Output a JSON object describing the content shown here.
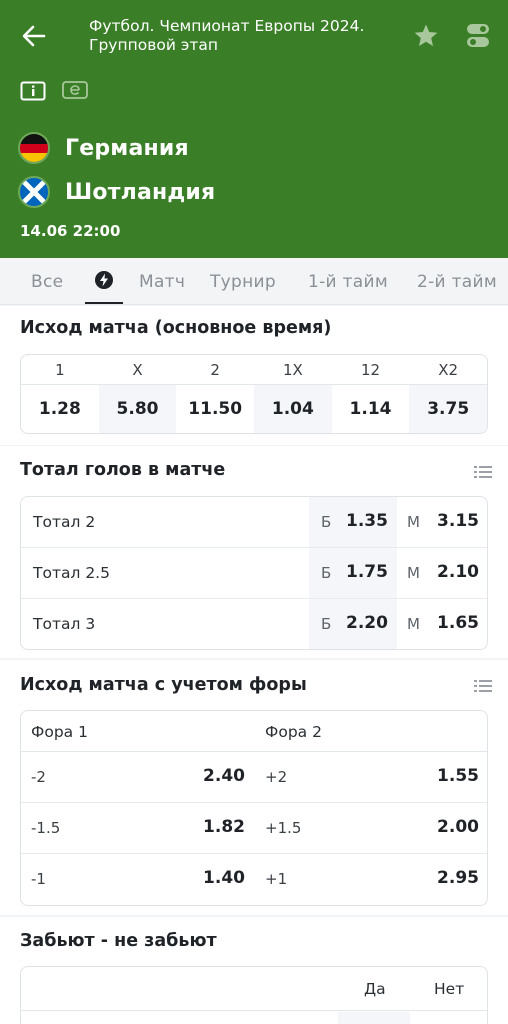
{
  "header": {
    "title_line1": "Футбол. Чемпионат Европы 2024.",
    "title_line2": "Групповой этап",
    "team1": "Германия",
    "team2": "Шотландия",
    "datetime": "14.06 22:00",
    "bg_color": "#3a7f27"
  },
  "tabs": [
    "Все",
    "Матч",
    "Турнир",
    "1-й тайм",
    "2-й тайм"
  ],
  "match_result": {
    "title": "Исход матча (основное время)",
    "columns": [
      {
        "label": "1",
        "odds": "1.28"
      },
      {
        "label": "X",
        "odds": "5.80"
      },
      {
        "label": "2",
        "odds": "11.50"
      },
      {
        "label": "1X",
        "odds": "1.04"
      },
      {
        "label": "12",
        "odds": "1.14"
      },
      {
        "label": "X2",
        "odds": "3.75"
      }
    ]
  },
  "totals": {
    "title": "Тотал голов в матче",
    "over_prefix": "Б",
    "under_prefix": "М",
    "rows": [
      {
        "label": "Тотал 2",
        "over": "1.35",
        "under": "3.15"
      },
      {
        "label": "Тотал 2.5",
        "over": "1.75",
        "under": "2.10"
      },
      {
        "label": "Тотал 3",
        "over": "2.20",
        "under": "1.65"
      }
    ]
  },
  "handicap": {
    "title": "Исход матча с учетом форы",
    "col1": "Фора 1",
    "col2": "Фора 2",
    "rows": [
      {
        "h1": "-2",
        "o1": "2.40",
        "h2": "+2",
        "o2": "1.55"
      },
      {
        "h1": "-1.5",
        "o1": "1.82",
        "h2": "+1.5",
        "o2": "2.00"
      },
      {
        "h1": "-1",
        "o1": "1.40",
        "h2": "+1",
        "o2": "2.95"
      }
    ]
  },
  "btts": {
    "title": "Забьют - не забьют",
    "yes": "Да",
    "no": "Нет"
  }
}
